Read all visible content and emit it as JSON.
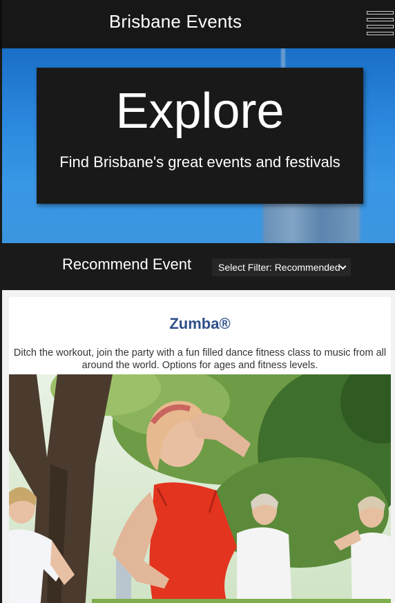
{
  "navbar": {
    "title": "Brisbane Events",
    "menu_icon": "hamburger-menu-icon"
  },
  "hero": {
    "heading": "Explore",
    "subtitle": "Find Brisbane's great events and festivals"
  },
  "filter_bar": {
    "heading": "Recommend Event",
    "select_value": "Select Filter: Recommended"
  },
  "event": {
    "title": "Zumba®",
    "description": "Ditch the workout, join the party with a fun filled dance fitness class to music from all around the world. Options for ages and fitness levels."
  },
  "colors": {
    "nav_background": "#171717",
    "event_title": "#2e4f8a",
    "hero_sky": "#2a86dc"
  }
}
